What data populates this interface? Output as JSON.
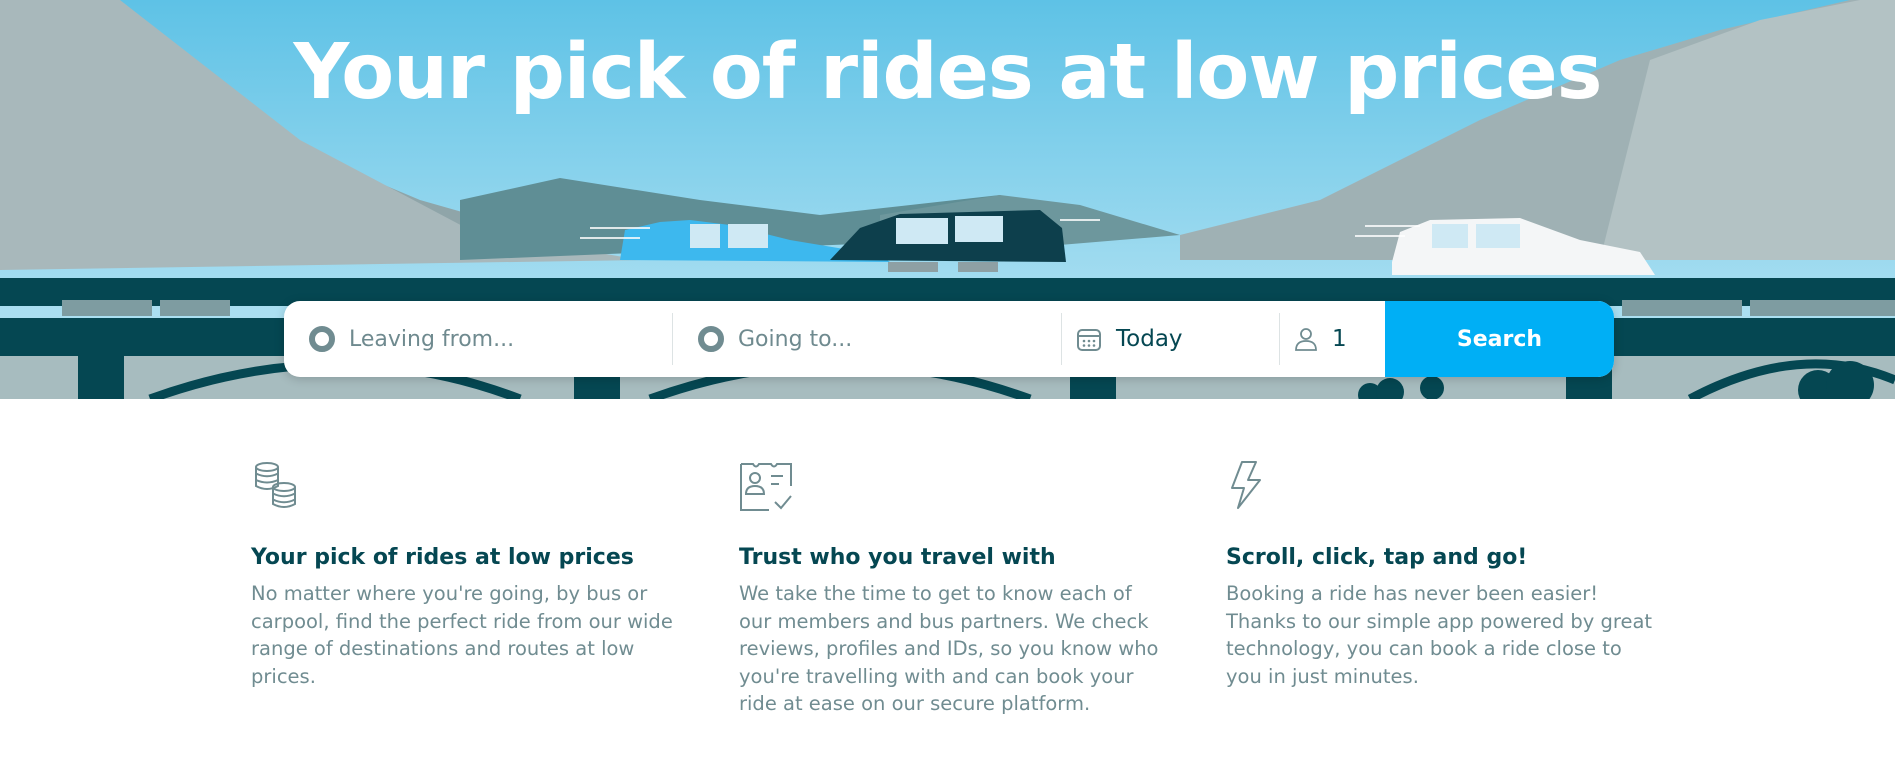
{
  "hero": {
    "title": "Your pick of rides at low prices"
  },
  "search": {
    "from_placeholder": "Leaving from...",
    "to_placeholder": "Going to...",
    "date_value": "Today",
    "passengers_value": "1",
    "button_label": "Search",
    "icons": {
      "from": "location-ring-icon",
      "to": "location-ring-icon",
      "date": "calendar-icon",
      "passengers": "person-icon"
    }
  },
  "features": [
    {
      "icon": "coins-icon",
      "title": "Your pick of rides at low prices",
      "text": "No matter where you're going, by bus or carpool, find the perfect ride from our wide range of destinations and routes at low prices."
    },
    {
      "icon": "id-card-check-icon",
      "title": "Trust who you travel with",
      "text": "We take the time to get to know each of our members and bus partners. We check reviews, profiles and IDs, so you know who you're travelling with and can book your ride at ease on our secure platform."
    },
    {
      "icon": "lightning-icon",
      "title": "Scroll, click, tap and go!",
      "text": "Booking a ride has never been easier! Thanks to our simple app powered by great technology, you can book a ride close to you in just minutes."
    }
  ],
  "colors": {
    "brand_blue": "#00aff5",
    "dark_teal": "#054752",
    "muted_text": "#708c91",
    "sky_top": "#5ec2e6",
    "sky_bottom": "#b6e4f3",
    "car_blue": "#3db8ee",
    "car_dark": "#0d3f4c",
    "car_white": "#f4f6f7"
  }
}
